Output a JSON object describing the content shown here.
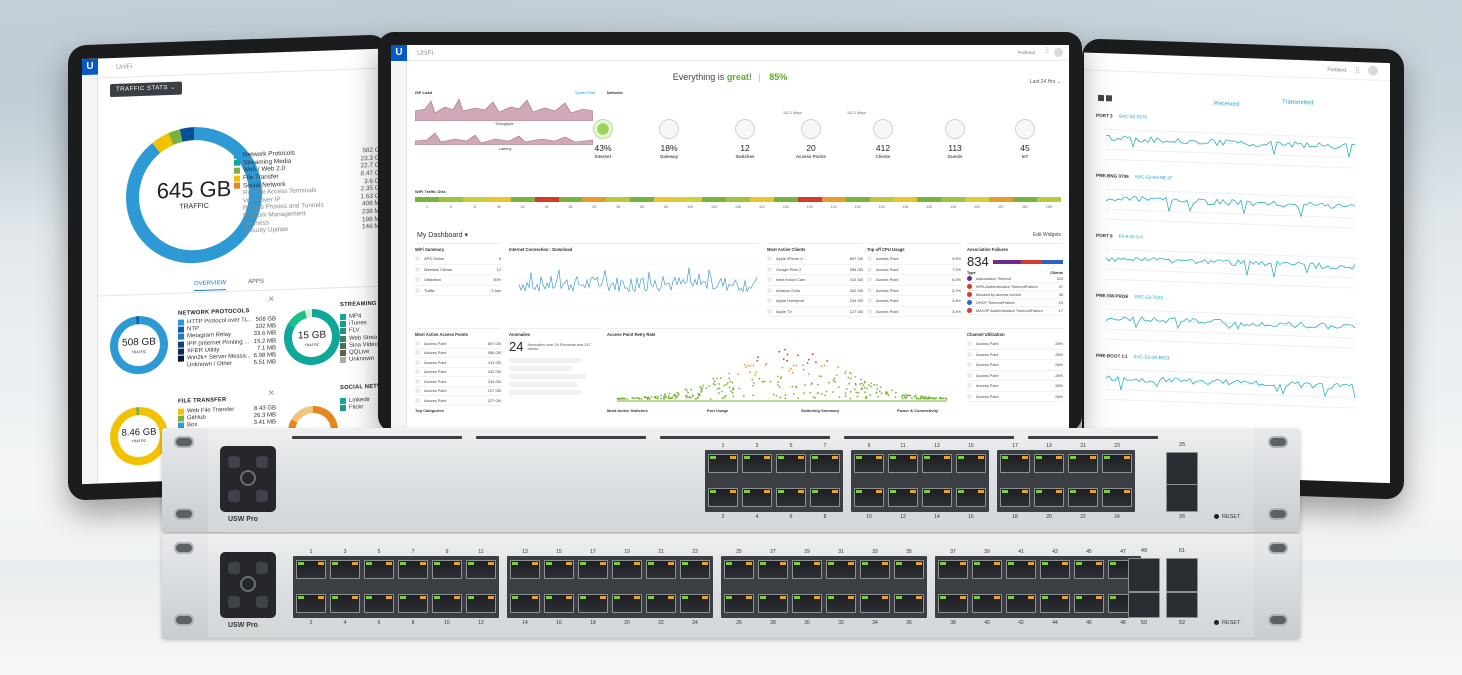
{
  "left_screen": {
    "badge": "U",
    "brand": "UniFi",
    "stats_button": "TRAFFIC STATS ⌄",
    "total": {
      "value": "645 GB",
      "label": "TRAFFIC"
    },
    "categories": [
      {
        "name": "Network Protocols",
        "value": "582 GB",
        "color": "#2d9ad6"
      },
      {
        "name": "Streaming Media",
        "value": "23.3 GB",
        "color": "#0fa79a"
      },
      {
        "name": "Web / Web 2.0",
        "value": "22.7 GB",
        "color": "#7ab33b"
      },
      {
        "name": "File Transfer",
        "value": "8.47 GB",
        "color": "#f2c200"
      },
      {
        "name": "Social Network",
        "value": "3.6 GB",
        "color": "#e6861e"
      },
      {
        "name": "Remote Access Terminals",
        "value": "2.35 GB",
        "color": ""
      },
      {
        "name": "Voice over IP",
        "value": "1.63 GB",
        "color": ""
      },
      {
        "name": "Bypass Proxies and Tunnels",
        "value": "408 MB",
        "color": ""
      },
      {
        "name": "Network Management",
        "value": "238 MB",
        "color": ""
      },
      {
        "name": "Business",
        "value": "198 MB",
        "color": ""
      },
      {
        "name": "Security Update",
        "value": "146 MB",
        "color": ""
      }
    ],
    "tabs": [
      "OVERVIEW",
      "APPS"
    ],
    "network_protocols": {
      "title": "NETWORK PROTOCOLS",
      "total": "508 GB",
      "total_label": "TRAFFIC",
      "rows": [
        {
          "name": "HTTP Protocol over TL...",
          "value": "508 GB",
          "color": "#2d9ad6"
        },
        {
          "name": "NTP",
          "value": "102 MB",
          "color": "#0b5fa8"
        },
        {
          "name": "Metagram Relay",
          "value": "33.6 MB",
          "color": "#1f7ac0"
        },
        {
          "name": "IPP (Internet Printing ...",
          "value": "15.2 MB",
          "color": "#123e73"
        },
        {
          "name": "XFER Utility",
          "value": "7.1 MB",
          "color": "#0d2a50"
        },
        {
          "name": "Win2k+ Server Messa...",
          "value": "6.98 MB",
          "color": "#081a33"
        },
        {
          "name": "Unknown / Other",
          "value": "5.51 MB",
          "color": ""
        }
      ]
    },
    "streaming": {
      "title": "STREAMING M",
      "total": "15 GB",
      "total_label": "TRAFFIC",
      "rows": [
        "MP4",
        "iTunes",
        "FLV",
        "Web Strea",
        "Sina Video",
        "QQLive",
        "Unknown"
      ]
    },
    "file_transfer": {
      "title": "FILE TRANSFER",
      "total": "8.46 GB",
      "total_label": "TRAFFIC",
      "rows": [
        {
          "name": "Web File Transfer",
          "value": "8.43 GB",
          "color": "#f2c200"
        },
        {
          "name": "GitHub",
          "value": "26.3 MB",
          "color": "#7ab33b"
        },
        {
          "name": "Box",
          "value": "3.41 MB",
          "color": "#2d9ad6"
        }
      ]
    },
    "social": {
      "title": "SOCIAL NETW",
      "rows": [
        "Linkedir",
        "Flickr"
      ]
    }
  },
  "main_screen": {
    "badge": "U",
    "brand": "UniFi",
    "site": "Portland",
    "status_prefix": "Everything is",
    "status_word": "great!",
    "status_pct": "85%",
    "range": "Last 24 Hrs",
    "isp_load": "ISP Load",
    "network_label": "Network",
    "speed_test": "Speed Test",
    "throughput": "Throughput",
    "latency": "Latency",
    "nodes": [
      {
        "num": "43%",
        "label": "Internet"
      },
      {
        "num": "18%",
        "label": "Gateway"
      },
      {
        "num": "12",
        "label": "Switches"
      },
      {
        "num": "20",
        "label": "Access Points"
      },
      {
        "num": "412",
        "label": "Clients"
      },
      {
        "num": "113",
        "label": "Guests"
      },
      {
        "num": "45",
        "label": "IoT"
      }
    ],
    "link_speeds": [
      "101.2 Mbps",
      "101.2 Mbps"
    ],
    "wifi_label": "WiFi Traffic Dist.",
    "channels": [
      "1",
      "6",
      "11",
      "36",
      "40",
      "44",
      "48",
      "52",
      "56",
      "60",
      "64",
      "100",
      "104",
      "108",
      "112",
      "116",
      "120",
      "124",
      "128",
      "132",
      "136",
      "140",
      "149",
      "153",
      "157",
      "161",
      "165"
    ],
    "channel_colors": [
      "#7ab33b",
      "#9cc43c",
      "#c8cf35",
      "#e8c52a",
      "#7ab33b",
      "#d53a2b",
      "#7ab33b",
      "#e99a2b",
      "#b9c93a",
      "#7ab33b",
      "#e8c52a",
      "#d7cf36",
      "#7ab33b",
      "#9cc43c",
      "#e8c52a",
      "#7ab33b",
      "#d53a2b",
      "#e99a2b",
      "#7ab33b",
      "#b9c93a",
      "#e8c52a",
      "#7ab33b",
      "#9cc43c",
      "#d7cf36",
      "#e99a2b",
      "#7ab33b",
      "#b9c93a"
    ],
    "dashboard_title": "My Dashboard",
    "edit_widgets": "Edit Widgets",
    "wifi_summary": {
      "title": "WiFi Summary",
      "rows": [
        {
          "name": "APS Online",
          "value": "8"
        },
        {
          "name": "Wireless Clients",
          "value": "12"
        },
        {
          "name": "Utilization",
          "value": "30%"
        },
        {
          "name": "Traffic",
          "value": "0 bps"
        }
      ]
    },
    "internet_connection": {
      "title": "Internet Connection : Download"
    },
    "most_active_clients": {
      "title": "Most Active Clients",
      "rows": [
        {
          "name": "Apple iPhone X",
          "value": "897 GB"
        },
        {
          "name": "Google Pixel 2",
          "value": "556 GB"
        },
        {
          "name": "Nest Indoor Cam",
          "value": "413 GB"
        },
        {
          "name": "Amazon Echo",
          "value": "342 GB"
        },
        {
          "name": "Apple Homepod",
          "value": "234 GB"
        },
        {
          "name": "Apple TV",
          "value": "127 GB"
        }
      ]
    },
    "top_cpu": {
      "title": "Top off CPU Usage",
      "rows": [
        {
          "name": "Access Point",
          "value": "9.8%"
        },
        {
          "name": "Access Point",
          "value": "7.2%"
        },
        {
          "name": "Access Point",
          "value": "6.3%"
        },
        {
          "name": "Access Point",
          "value": "5.2%"
        },
        {
          "name": "Access Point",
          "value": "3.8%"
        },
        {
          "name": "Access Point",
          "value": "3.4%"
        }
      ]
    },
    "association": {
      "title": "Association Failures",
      "count": "834",
      "type_h": "Type",
      "clients_h": "Clients",
      "rows": [
        {
          "name": "Association Timeout",
          "value": "323"
        },
        {
          "name": "WPA Authentication Timeout/Failure",
          "value": "57"
        },
        {
          "name": "Blocked by access control",
          "value": "45"
        },
        {
          "name": "DHCP Timeout/Failure",
          "value": "23"
        },
        {
          "name": "MAC/IP Authentication Timeout/Failure",
          "value": "17"
        }
      ]
    },
    "most_active_aps": {
      "title": "Most Active Access Points",
      "rows": [
        {
          "name": "Access Point",
          "value": "897 GB"
        },
        {
          "name": "Access Point",
          "value": "556 GB"
        },
        {
          "name": "Access Point",
          "value": "413 GB"
        },
        {
          "name": "Access Point",
          "value": "342 GB"
        },
        {
          "name": "Access Point",
          "value": "234 GB"
        },
        {
          "name": "Access Point",
          "value": "127 GB"
        },
        {
          "name": "Access Point",
          "value": "127 GB"
        }
      ]
    },
    "anomalies": {
      "title": "Anomalies",
      "count": "24",
      "summary": "Anomalies over 24 Elements and 247 clients"
    },
    "retry_rate": {
      "title": "Access Point Retry Rate"
    },
    "channel_util": {
      "title": "Channel Utilization",
      "rows": [
        {
          "name": "Access Point",
          "value": "28%"
        },
        {
          "name": "Access Point",
          "value": "28%"
        },
        {
          "name": "Access Point",
          "value": "28%"
        },
        {
          "name": "Access Point",
          "value": "28%"
        },
        {
          "name": "Access Point",
          "value": "28%"
        },
        {
          "name": "Access Point",
          "value": "28%"
        }
      ]
    },
    "bottom_titles": [
      "Top Categories",
      "Most Active Switches",
      "Port Usage",
      "Switching Summary",
      "Power & Connectivity"
    ]
  },
  "right_screen": {
    "site": "Portland",
    "tabs": [
      "Received",
      "Transmitted"
    ],
    "charts": [
      {
        "port": "PORT 3",
        "mac": "SVC-S2-0375"
      },
      {
        "port": "PRE-BNG 0706",
        "mac": "SVC-S2-00-NB:37"
      },
      {
        "port": "PORT 9",
        "mac": "F4-9-02-0-4"
      },
      {
        "port": "PRE-SW.PROE",
        "mac": "SPC-S2-7023"
      },
      {
        "port": "PRE-BOOT C1",
        "mac": "SVC-S2-0A-B023"
      }
    ]
  },
  "switch_top": {
    "model": "USW Pro",
    "top_labels": [
      "1",
      "3",
      "5",
      "7",
      "9",
      "11",
      "13",
      "15",
      "17",
      "19",
      "21",
      "23"
    ],
    "bottom_labels": [
      "2",
      "4",
      "6",
      "8",
      "10",
      "12",
      "14",
      "16",
      "18",
      "20",
      "22",
      "24"
    ],
    "sfp": [
      "25",
      "26"
    ],
    "reset": "RESET"
  },
  "switch_bottom": {
    "model": "USW Pro",
    "top_labels": [
      "1",
      "3",
      "5",
      "7",
      "9",
      "11",
      "13",
      "15",
      "17",
      "19",
      "21",
      "23",
      "25",
      "27",
      "29",
      "31",
      "33",
      "35",
      "37",
      "39",
      "41",
      "43",
      "45",
      "47"
    ],
    "bottom_labels": [
      "2",
      "4",
      "6",
      "8",
      "10",
      "12",
      "14",
      "16",
      "18",
      "20",
      "22",
      "24",
      "26",
      "28",
      "30",
      "32",
      "34",
      "36",
      "38",
      "40",
      "42",
      "44",
      "46",
      "48"
    ],
    "sfp": [
      "49",
      "51",
      "50",
      "52"
    ],
    "reset": "RESET"
  }
}
